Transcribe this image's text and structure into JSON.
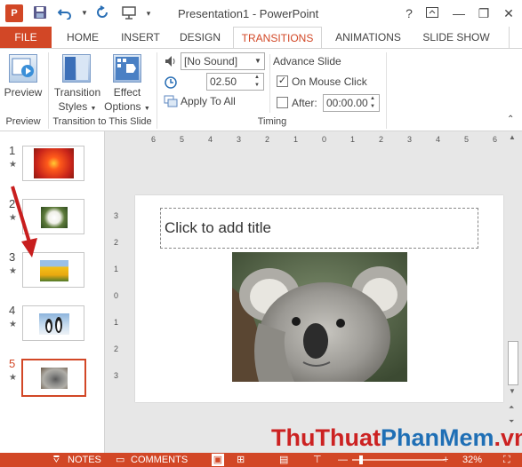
{
  "app": {
    "icon_letter": "P",
    "window_title": "Presentation1 - PowerPoint",
    "help_label": "?",
    "window_buttons": [
      "ribbon-display-icon",
      "minimize-icon",
      "restore-icon",
      "close-icon"
    ]
  },
  "qat": [
    "save-icon",
    "undo-icon",
    "redo-icon",
    "start-slideshow-icon"
  ],
  "tabs": [
    "FILE",
    "HOME",
    "INSERT",
    "DESIGN",
    "TRANSITIONS",
    "ANIMATIONS",
    "SLIDE SHOW"
  ],
  "active_tab": "TRANSITIONS",
  "ribbon": {
    "preview_group": {
      "button": "Preview",
      "label": "Preview"
    },
    "transition_group": {
      "styles_line1": "Transition",
      "styles_line2": "Styles",
      "effect_line1": "Effect",
      "effect_line2": "Options",
      "label": "Transition to This Slide"
    },
    "timing_group": {
      "sound_value": "[No Sound]",
      "duration_value": "02.50",
      "apply_all": "Apply To All",
      "advance_title": "Advance Slide",
      "on_mouse_click": "On Mouse Click",
      "on_mouse_click_checked": true,
      "after_label": "After:",
      "after_checked": false,
      "after_value": "00:00.00",
      "label": "Timing"
    }
  },
  "thumbnails": [
    {
      "num": "1",
      "star": "★",
      "image": "red-flower"
    },
    {
      "num": "2",
      "star": "★",
      "image": "white-flower"
    },
    {
      "num": "3",
      "star": "★",
      "image": "yellow-tulips"
    },
    {
      "num": "4",
      "star": "★",
      "image": "penguins"
    },
    {
      "num": "5",
      "star": "★",
      "image": "koala",
      "selected": true
    }
  ],
  "rulers": {
    "horizontal": [
      "6",
      "5",
      "4",
      "3",
      "2",
      "1",
      "0",
      "1",
      "2",
      "3",
      "4",
      "5",
      "6"
    ],
    "vertical": [
      "3",
      "2",
      "1",
      "0",
      "1",
      "2",
      "3"
    ]
  },
  "slide": {
    "title_placeholder": "Click to add title",
    "image": "koala"
  },
  "status": {
    "notes": "NOTES",
    "comments": "COMMENTS",
    "zoom": "32%"
  },
  "watermark": {
    "part1": "ThuThuat",
    "part2": "PhanMem",
    "part3": ".vn"
  },
  "colors": {
    "accent": "#d24726",
    "watermark_red": "#cc2222",
    "watermark_blue": "#1f6fb5"
  }
}
